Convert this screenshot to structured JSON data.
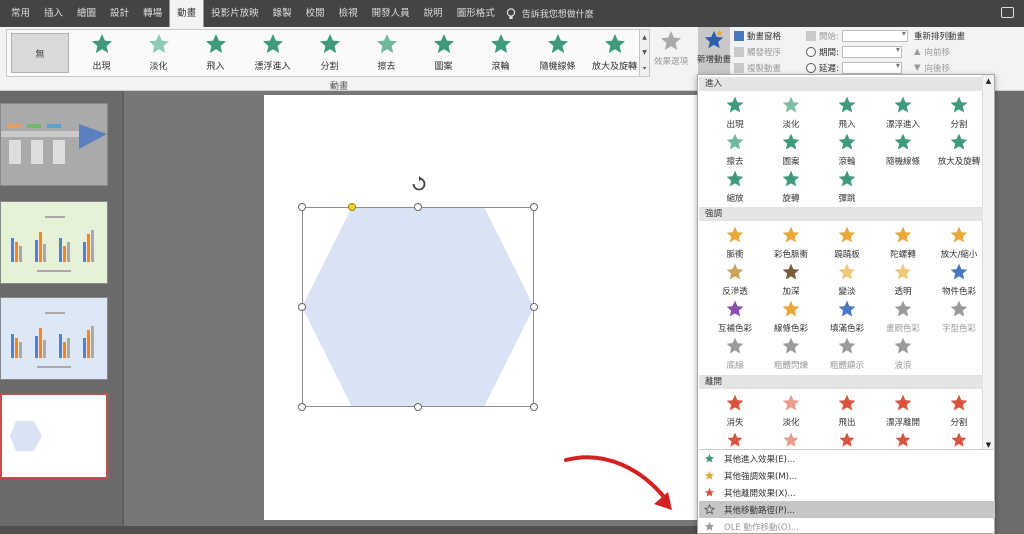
{
  "tabs": [
    "常用",
    "插入",
    "繪圖",
    "設計",
    "轉場",
    "動畫",
    "投影片放映",
    "錄製",
    "校閱",
    "檢視",
    "開發人員",
    "說明",
    "圖形格式"
  ],
  "active_tab": "動畫",
  "tell_me": "告訴我您想做什麼",
  "ribbon": {
    "none_label": "無",
    "gallery": [
      {
        "label": "出現",
        "color": "#3f9a7a"
      },
      {
        "label": "淡化",
        "color": "#8fc9b3"
      },
      {
        "label": "飛入",
        "color": "#3f9a7a"
      },
      {
        "label": "漂浮進入",
        "color": "#3f9a7a"
      },
      {
        "label": "分割",
        "color": "#3f9a7a"
      },
      {
        "label": "擦去",
        "color": "#6fb89c"
      },
      {
        "label": "圖案",
        "color": "#3f9a7a"
      },
      {
        "label": "滾輪",
        "color": "#3f9a7a"
      },
      {
        "label": "隨機線條",
        "color": "#3f9a7a"
      },
      {
        "label": "放大及旋轉",
        "color": "#3f9a7a"
      }
    ],
    "effect_options": "效果選項",
    "group_label": "動畫",
    "add_animation": "新增動畫",
    "animation_pane": "動畫窗格",
    "trigger": "觸發程序",
    "painter": "複製動畫",
    "start": "開始:",
    "duration": "期間:",
    "delay": "延遲:",
    "reorder": "重新排列動畫",
    "move_earlier": "向前移",
    "move_later": "向後移"
  },
  "panel": {
    "sections": [
      "進入",
      "強調",
      "離開"
    ],
    "entrance": [
      {
        "label": "出現",
        "color": "#3f9a7a"
      },
      {
        "label": "淡化",
        "color": "#7fbfa6"
      },
      {
        "label": "飛入",
        "color": "#3f9a7a"
      },
      {
        "label": "漂浮進入",
        "color": "#3f9a7a"
      },
      {
        "label": "分割",
        "color": "#3f9a7a"
      },
      {
        "label": "擦去",
        "color": "#6fb89c"
      },
      {
        "label": "圖案",
        "color": "#3f9a7a"
      },
      {
        "label": "滾輪",
        "color": "#3f9a7a"
      },
      {
        "label": "隨機線條",
        "color": "#3f9a7a"
      },
      {
        "label": "放大及旋轉",
        "color": "#3f9a7a"
      },
      {
        "label": "縮放",
        "color": "#3f9a7a"
      },
      {
        "label": "旋轉",
        "color": "#3f9a7a"
      },
      {
        "label": "彈跳",
        "color": "#3f9a7a"
      }
    ],
    "emphasis": [
      {
        "label": "脈衝",
        "color": "#e7a93b",
        "disabled": false
      },
      {
        "label": "彩色脈衝",
        "color": "#e7a93b",
        "disabled": false
      },
      {
        "label": "蹺蹺板",
        "color": "#e7a93b",
        "disabled": false
      },
      {
        "label": "陀螺轉",
        "color": "#e7a93b",
        "disabled": false
      },
      {
        "label": "放大/縮小",
        "color": "#e7a93b",
        "disabled": false
      },
      {
        "label": "反滲透",
        "color": "#c9a35b",
        "disabled": false
      },
      {
        "label": "加深",
        "color": "#7a5d3a",
        "disabled": false
      },
      {
        "label": "變淡",
        "color": "#f0c978",
        "disabled": false
      },
      {
        "label": "透明",
        "color": "#f0c978",
        "disabled": false
      },
      {
        "label": "物件色彩",
        "color": "#4a78c0",
        "disabled": false
      },
      {
        "label": "互補色彩",
        "color": "#8a4fb0",
        "disabled": false
      },
      {
        "label": "線條色彩",
        "color": "#e7a93b",
        "disabled": false
      },
      {
        "label": "填滿色彩",
        "color": "#4a78c0",
        "disabled": false
      },
      {
        "label": "畫刷色彩",
        "color": "#9a9a9a",
        "disabled": true
      },
      {
        "label": "字型色彩",
        "color": "#9a9a9a",
        "disabled": true
      },
      {
        "label": "底線",
        "color": "#9a9a9a",
        "disabled": true
      },
      {
        "label": "粗體閃爍",
        "color": "#9a9a9a",
        "disabled": true
      },
      {
        "label": "粗體顯示",
        "color": "#9a9a9a",
        "disabled": true
      },
      {
        "label": "波浪",
        "color": "#9a9a9a",
        "disabled": true
      }
    ],
    "exit": [
      {
        "label": "消失",
        "color": "#d9543f"
      },
      {
        "label": "淡化",
        "color": "#ec9c8c"
      },
      {
        "label": "飛出",
        "color": "#d9543f"
      },
      {
        "label": "漂浮離開",
        "color": "#d9543f"
      },
      {
        "label": "分割",
        "color": "#d9543f"
      }
    ],
    "more": [
      {
        "label": "其他進入效果(E)...",
        "color": "#3f9a7a",
        "highlight": false,
        "disabled": false
      },
      {
        "label": "其他強調效果(M)...",
        "color": "#e7a93b",
        "highlight": false,
        "disabled": false
      },
      {
        "label": "其他離開效果(X)...",
        "color": "#d9543f",
        "highlight": false,
        "disabled": false
      },
      {
        "label": "其他移動路徑(P)...",
        "color": "#ffffff",
        "highlight": true,
        "disabled": false
      },
      {
        "label": "OLE 動作移動(O)...",
        "color": "#9a9a9a",
        "highlight": false,
        "disabled": true
      }
    ]
  },
  "shape": {
    "fill": "#dae3f3"
  },
  "colors": {
    "arrow": "#d42020",
    "accent": "#3f9a7a"
  }
}
